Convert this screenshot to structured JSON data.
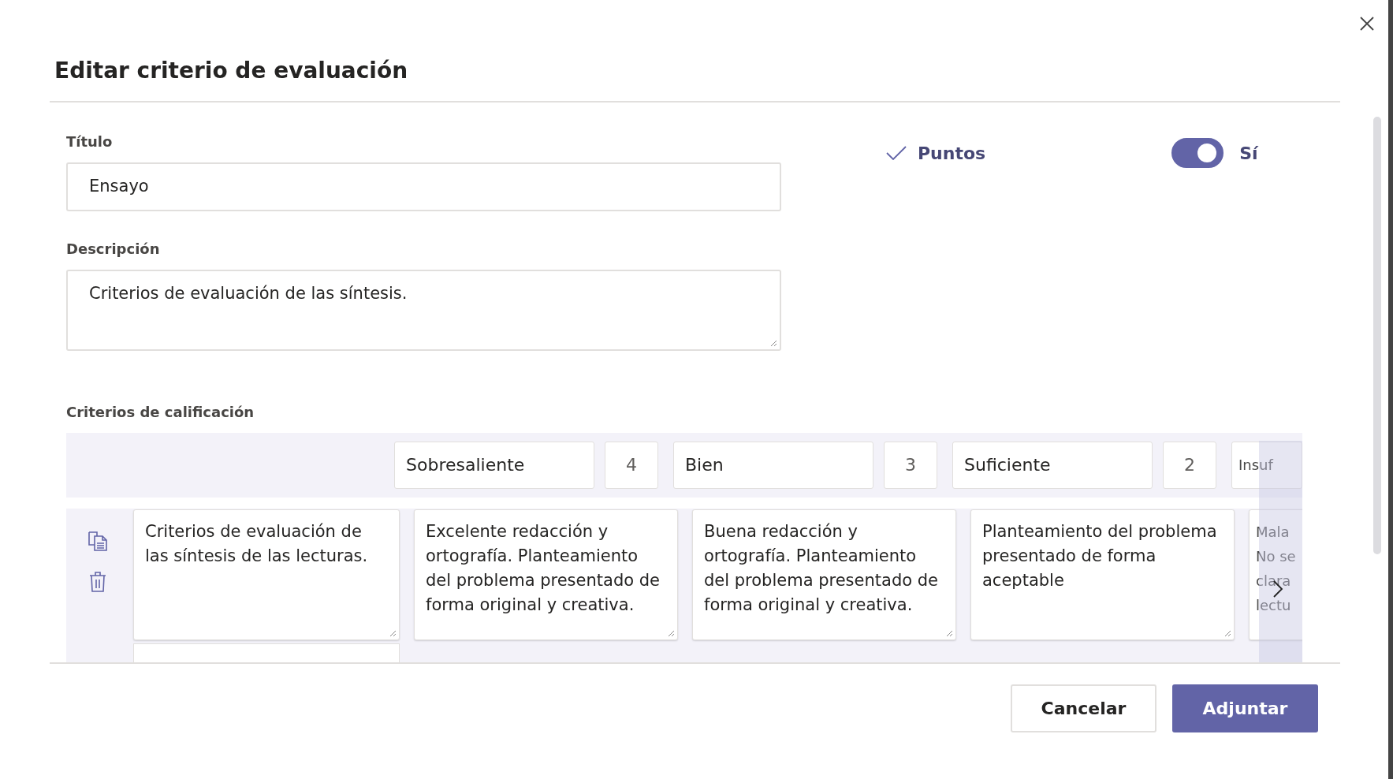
{
  "dialog": {
    "title": "Editar criterio de evaluación"
  },
  "title_field": {
    "label": "Título",
    "value": "Ensayo"
  },
  "description_field": {
    "label": "Descripción",
    "value": "Criterios de evaluación de las síntesis."
  },
  "points": {
    "label": "Puntos",
    "checked": true
  },
  "points_toggle": {
    "on": true,
    "label": "Sí"
  },
  "grading": {
    "label": "Criterios de calificación",
    "levels": [
      {
        "name": "Sobresaliente",
        "score": "4"
      },
      {
        "name": "Bien",
        "score": "3"
      },
      {
        "name": "Suficiente",
        "score": "2"
      },
      {
        "name": "Insuf"
      }
    ],
    "rows": [
      {
        "criterion": "Criterios de evaluación de las síntesis de las lecturas.",
        "descriptions": [
          "Excelente redacción y ortografía. Planteamiento del problema presentado de forma original y creativa.",
          "Buena redacción y ortografía. Planteamiento del problema presentado de forma original y creativa.",
          "Planteamiento del problema presentado de forma aceptable",
          "Mala\nNo se\nclara\nlectu"
        ]
      }
    ]
  },
  "buttons": [
    {
      "label": "Cancelar",
      "kind": "secondary"
    },
    {
      "label": "Adjuntar",
      "kind": "primary"
    }
  ]
}
